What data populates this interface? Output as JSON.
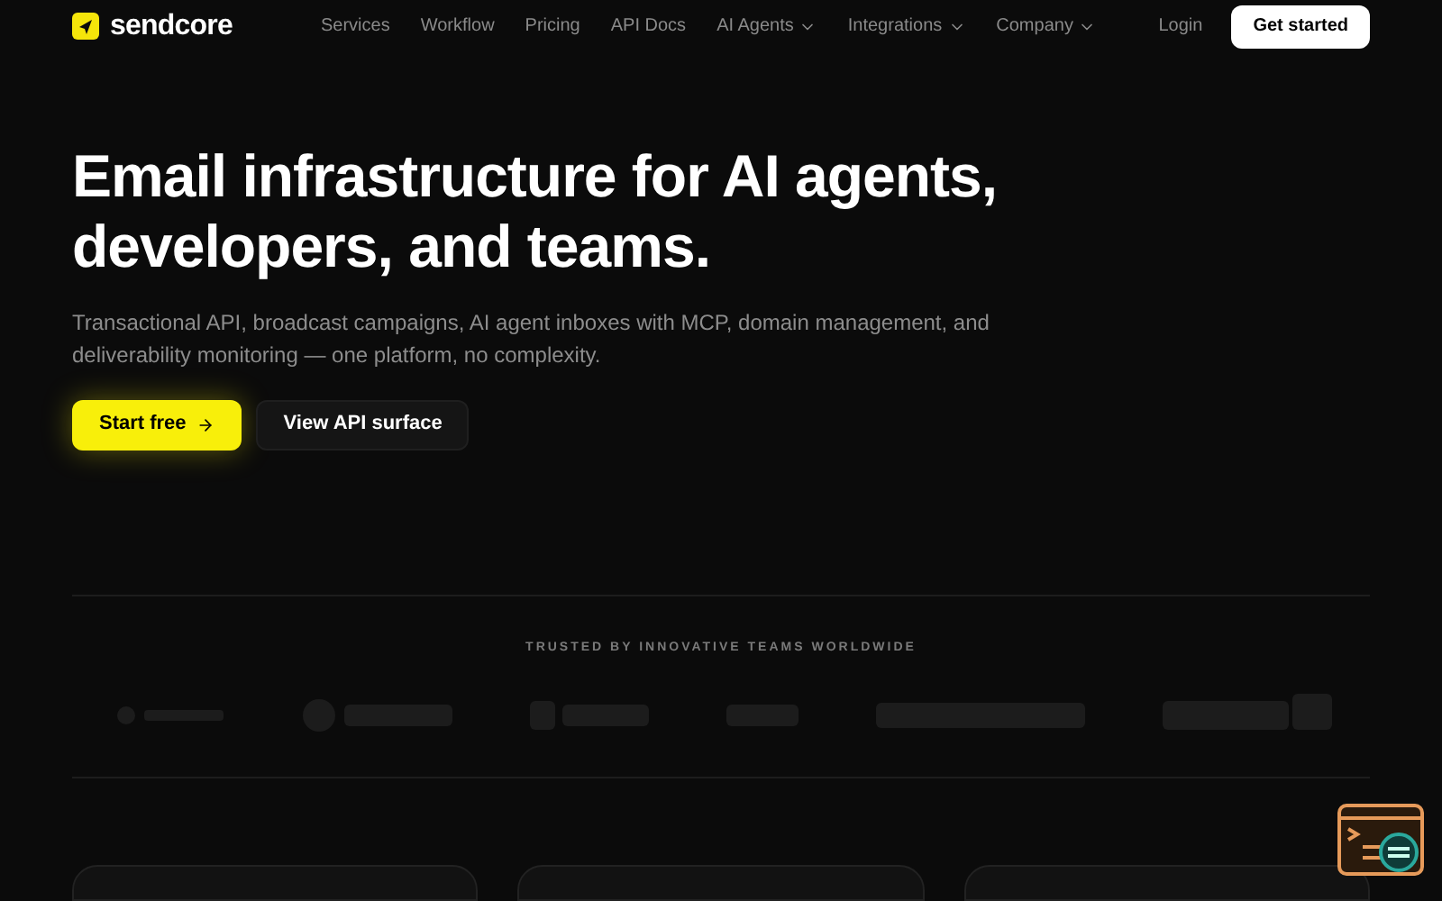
{
  "brand": {
    "name": "sendcore"
  },
  "nav": [
    {
      "label": "Services",
      "dropdown": false
    },
    {
      "label": "Workflow",
      "dropdown": false
    },
    {
      "label": "Pricing",
      "dropdown": false
    },
    {
      "label": "API Docs",
      "dropdown": false
    },
    {
      "label": "AI Agents",
      "dropdown": true
    },
    {
      "label": "Integrations",
      "dropdown": true
    },
    {
      "label": "Company",
      "dropdown": true
    }
  ],
  "auth": {
    "login": "Login",
    "cta": "Get started"
  },
  "hero": {
    "title": "Email infrastructure for AI agents, developers, and teams.",
    "subtitle": "Transactional API, broadcast campaigns, AI agent inboxes with MCP, domain management, and deliverability monitoring — one platform, no complexity.",
    "primary": "Start free",
    "secondary": "View API surface"
  },
  "trusted": {
    "heading": "TRUSTED BY INNOVATIVE TEAMS WORLDWIDE",
    "logos": [
      {
        "kind": "dot"
      },
      {
        "kind": "circle"
      },
      {
        "kind": "square"
      },
      {
        "kind": "bars"
      },
      {
        "kind": "wide"
      },
      {
        "kind": "box"
      }
    ]
  }
}
